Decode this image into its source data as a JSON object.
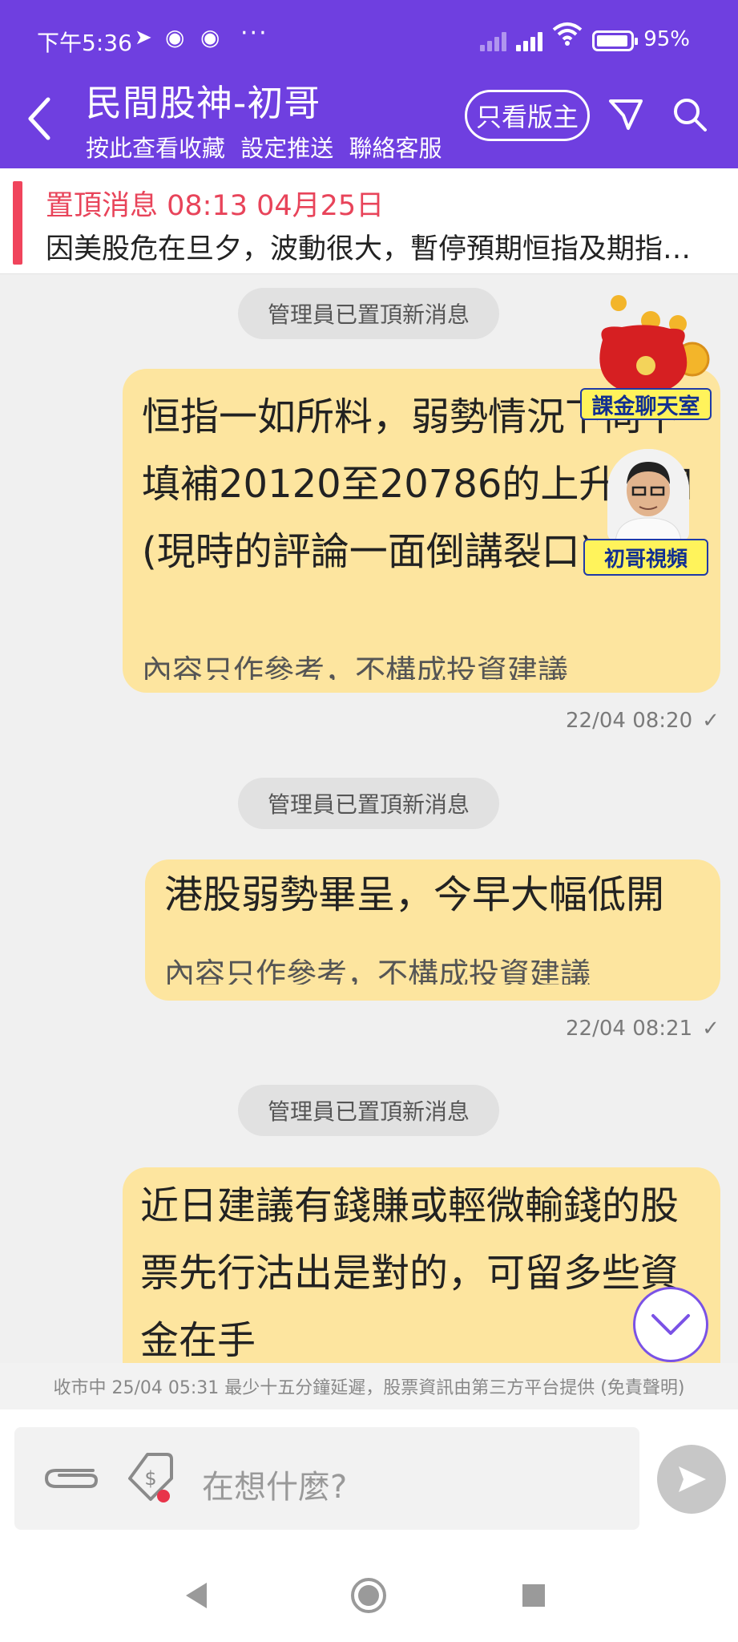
{
  "status_bar": {
    "time": "下午5:36",
    "battery": "95%",
    "battery_level": 0.95
  },
  "header": {
    "title": "民間股神-初哥",
    "links": [
      "按此查看收藏",
      "設定推送",
      "聯絡客服"
    ],
    "owner_only_button": "只看版主",
    "icons": [
      "back-arrow-icon",
      "filter-icon",
      "search-icon"
    ]
  },
  "pinned": {
    "label": "置頂消息 08:13 04月25日",
    "text": "因美股危在旦夕，波動很大，暫停預期恒指及期指…"
  },
  "system_notice": "管理員已置頂新消息",
  "messages": [
    {
      "text": "恒指一如所料，弱勢情況下向下填補20120至20786的上升裂口(現時的評論一面倒講裂口)",
      "disclaimer": "內容只作參考，不構成投資建議",
      "time": "22/04 08:20"
    },
    {
      "text": "港股弱勢畢呈，今早大幅低開",
      "disclaimer": "內容只作參考，不構成投資建議",
      "time": "22/04 08:21"
    },
    {
      "text": "近日建議有錢賺或輕微輸錢的股票先行沽出是對的，可留多些資金在手"
    }
  ],
  "widgets": {
    "room_tag": "課金聊天室",
    "video_tag": "初哥視頻"
  },
  "ticker": "收市中 25/04 05:31 最少十五分鐘延遲，股票資訊由第三方平台提供 (免責聲明)",
  "composer": {
    "placeholder": "在想什麼?"
  },
  "colors": {
    "header": "#6f3fe0",
    "bubble": "#fde59f",
    "pinned_accent": "#e8445a"
  }
}
